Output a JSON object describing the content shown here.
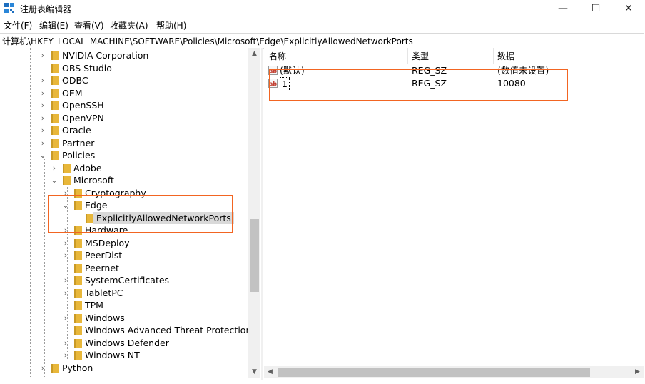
{
  "window": {
    "title": "注册表编辑器",
    "controls": {
      "minimize": "—",
      "maximize": "☐",
      "close": "✕"
    }
  },
  "menu": [
    "文件(F)",
    "编辑(E)",
    "查看(V)",
    "收藏夹(A)",
    "帮助(H)"
  ],
  "address": "计算机\\HKEY_LOCAL_MACHINE\\SOFTWARE\\Policies\\Microsoft\\Edge\\ExplicitlyAllowedNetworkPorts",
  "tree": [
    {
      "label": "NVIDIA Corporation",
      "level": 0,
      "expander": "›"
    },
    {
      "label": "OBS Studio",
      "level": 0,
      "expander": ""
    },
    {
      "label": "ODBC",
      "level": 0,
      "expander": "›"
    },
    {
      "label": "OEM",
      "level": 0,
      "expander": "›"
    },
    {
      "label": "OpenSSH",
      "level": 0,
      "expander": "›"
    },
    {
      "label": "OpenVPN",
      "level": 0,
      "expander": "›"
    },
    {
      "label": "Oracle",
      "level": 0,
      "expander": "›"
    },
    {
      "label": "Partner",
      "level": 0,
      "expander": "›"
    },
    {
      "label": "Policies",
      "level": 0,
      "expander": "⌄"
    },
    {
      "label": "Adobe",
      "level": 1,
      "expander": "›"
    },
    {
      "label": "Microsoft",
      "level": 1,
      "expander": "⌄"
    },
    {
      "label": "Cryptography",
      "level": 2,
      "expander": "›"
    },
    {
      "label": "Edge",
      "level": 2,
      "expander": "⌄"
    },
    {
      "label": "ExplicitlyAllowedNetworkPorts",
      "level": 3,
      "expander": "",
      "selected": true
    },
    {
      "label": "Hardware",
      "level": 2,
      "expander": "›"
    },
    {
      "label": "MSDeploy",
      "level": 2,
      "expander": "›"
    },
    {
      "label": "PeerDist",
      "level": 2,
      "expander": "›"
    },
    {
      "label": "Peernet",
      "level": 2,
      "expander": ""
    },
    {
      "label": "SystemCertificates",
      "level": 2,
      "expander": "›"
    },
    {
      "label": "TabletPC",
      "level": 2,
      "expander": "›"
    },
    {
      "label": "TPM",
      "level": 2,
      "expander": ""
    },
    {
      "label": "Windows",
      "level": 2,
      "expander": "›"
    },
    {
      "label": "Windows Advanced Threat Protection",
      "level": 2,
      "expander": ""
    },
    {
      "label": "Windows Defender",
      "level": 2,
      "expander": "›"
    },
    {
      "label": "Windows NT",
      "level": 2,
      "expander": "›"
    },
    {
      "label": "Python",
      "level": 0,
      "expander": "›"
    }
  ],
  "list": {
    "columns": [
      "名称",
      "类型",
      "数据"
    ],
    "rows": [
      {
        "icon": "ab",
        "name": "(默认)",
        "type": "REG_SZ",
        "data": "(数值未设置)"
      },
      {
        "icon": "ab",
        "name": "1",
        "type": "REG_SZ",
        "data": "10080"
      }
    ]
  },
  "colors": {
    "highlight": "#f26522",
    "folder": "#e8b73a",
    "selection": "#d9d9d9"
  },
  "icons": {
    "app": "regedit-icon",
    "folder": "folder-icon",
    "value": "string-value-icon"
  }
}
